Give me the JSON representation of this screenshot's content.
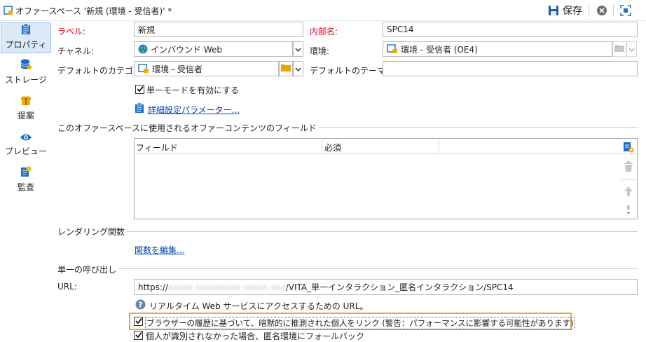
{
  "window": {
    "title": "オファースペース '新規 (環境 - 受信者)' *",
    "save_label": "保存"
  },
  "sidebar": {
    "items": [
      {
        "label": "プロパティ",
        "icon": "clipboard-icon"
      },
      {
        "label": "ストレージ",
        "icon": "database-icon"
      },
      {
        "label": "提案",
        "icon": "gift-icon"
      },
      {
        "label": "プレビュー",
        "icon": "eye-icon"
      },
      {
        "label": "監査",
        "icon": "audit-icon"
      }
    ]
  },
  "form": {
    "label_label": "ラベル:",
    "label_value": "新規",
    "internal_name_label": "内部名:",
    "internal_name_value": "SPC14",
    "channel_label": "チャネル:",
    "channel_value": "インバウンド Web",
    "environment_label": "環境:",
    "environment_value": "環境 - 受信者 (OE4)",
    "default_category_label": "デフォルトのカテゴリ:",
    "default_category_value": "環境 - 受信者",
    "default_theme_label": "デフォルトのテーマ:",
    "default_theme_value": "",
    "single_mode_label": "単一モードを有効にする",
    "advanced_params_link": "詳細設定パラメーター..."
  },
  "fields_section": {
    "title": "このオファースペースに使用されるオファーコンテンツのフィールド",
    "columns": [
      "フィールド",
      "必須"
    ]
  },
  "rendering_section": {
    "title": "レンダリング関数",
    "edit_link": "関数を編集..."
  },
  "single_call_section": {
    "title": "単一の呼び出し",
    "url_label": "URL:",
    "url_prefix": "https://",
    "url_hidden": "xxxxx.xxxxxxxxx.xxxxx.xxx",
    "url_suffix": "/VITA_単一インタラクション_匿名インタラクション/SPC14",
    "url_help": "リアルタイム Web サービスにアクセスするための URL。",
    "implicit_identify_label": "ブラウザーの履歴に基づいて、暗黙的に推測された個人をリンク (警告：パフォーマンスに影響する可能性があります)",
    "fallback_label": "個人が識別されなかった場合、匿名環境にフォールバック"
  },
  "colors": {
    "accent_blue": "#1a6fc9",
    "required_red": "#e0001b",
    "highlight_orange": "#f0a050",
    "active_tab_bg": "#dbe9f8"
  }
}
